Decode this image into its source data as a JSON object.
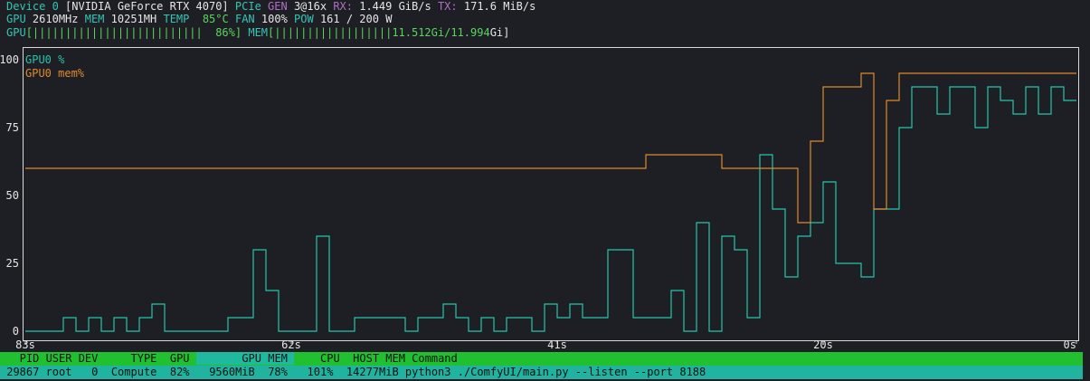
{
  "device": {
    "label": "Device 0",
    "name": "[NVIDIA GeForce RTX 4070]",
    "pcie_label": "PCIe",
    "gen_label": "GEN",
    "gen_value": "3@16x",
    "rx_label": "RX:",
    "rx_value": "1.449 GiB/s",
    "tx_label": "TX:",
    "tx_value": "171.6 MiB/s"
  },
  "stats": {
    "gpu_label": "GPU",
    "gpu_clock": "2610MHz",
    "mem_label": "MEM",
    "mem_clock": "10251MH",
    "temp_label": "TEMP",
    "temp_value": "85°C",
    "fan_label": "FAN",
    "fan_value": "100%",
    "pow_label": "POW",
    "pow_value": "161 / 200 W"
  },
  "bars": {
    "gpu_label": "GPU",
    "gpu_bar": "[||||||||||||||||||||||||||  86%]",
    "mem_label": "MEM",
    "mem_bar_open": "[||||||||||||||||||",
    "mem_bar_value": "11.512Gi/11.994",
    "mem_bar_close": "Gi]"
  },
  "chart_data": {
    "type": "line",
    "series": [
      {
        "name": "GPU0 %",
        "color": "#26c4aa",
        "x": [
          83,
          82,
          81,
          80,
          79,
          78,
          77,
          76,
          75,
          74,
          73,
          72,
          71,
          70,
          69,
          68,
          67,
          66,
          65,
          64,
          63,
          62,
          61,
          60,
          59,
          58,
          57,
          56,
          55,
          54,
          53,
          52,
          51,
          50,
          49,
          48,
          47,
          46,
          45,
          44,
          43,
          42,
          41,
          40,
          39,
          38,
          37,
          36,
          35,
          34,
          33,
          32,
          31,
          30,
          29,
          28,
          27,
          26,
          25,
          24,
          23,
          22,
          21,
          20,
          19,
          18,
          17,
          16,
          15,
          14,
          13,
          12,
          11,
          10,
          9,
          8,
          7,
          6,
          5,
          4,
          3,
          2,
          1,
          0
        ],
        "values": [
          0,
          0,
          0,
          5,
          0,
          5,
          0,
          5,
          0,
          5,
          10,
          0,
          0,
          0,
          0,
          0,
          5,
          5,
          30,
          15,
          0,
          0,
          0,
          35,
          0,
          0,
          5,
          5,
          5,
          5,
          0,
          5,
          5,
          10,
          5,
          0,
          5,
          0,
          5,
          5,
          0,
          10,
          5,
          10,
          5,
          5,
          30,
          30,
          5,
          5,
          5,
          15,
          0,
          40,
          0,
          35,
          30,
          5,
          65,
          45,
          20,
          35,
          40,
          55,
          25,
          25,
          20,
          45,
          45,
          75,
          90,
          90,
          80,
          90,
          90,
          75,
          90,
          85,
          80,
          90,
          80,
          90,
          85,
          85
        ]
      },
      {
        "name": "GPU0 mem%",
        "color": "#e08a2c",
        "x": [
          83,
          82,
          81,
          80,
          79,
          78,
          77,
          76,
          75,
          74,
          73,
          72,
          71,
          70,
          69,
          68,
          67,
          66,
          65,
          64,
          63,
          62,
          61,
          60,
          59,
          58,
          57,
          56,
          55,
          54,
          53,
          52,
          51,
          50,
          49,
          48,
          47,
          46,
          45,
          44,
          43,
          42,
          41,
          40,
          39,
          38,
          37,
          36,
          35,
          34,
          33,
          32,
          31,
          30,
          29,
          28,
          27,
          26,
          25,
          24,
          23,
          22,
          21,
          20,
          19,
          18,
          17,
          16,
          15,
          14,
          13,
          12,
          11,
          10,
          9,
          8,
          7,
          6,
          5,
          4,
          3,
          2,
          1,
          0
        ],
        "values": [
          60,
          60,
          60,
          60,
          60,
          60,
          60,
          60,
          60,
          60,
          60,
          60,
          60,
          60,
          60,
          60,
          60,
          60,
          60,
          60,
          60,
          60,
          60,
          60,
          60,
          60,
          60,
          60,
          60,
          60,
          60,
          60,
          60,
          60,
          60,
          60,
          60,
          60,
          60,
          60,
          60,
          60,
          60,
          60,
          60,
          60,
          60,
          60,
          60,
          65,
          65,
          65,
          65,
          65,
          65,
          60,
          60,
          60,
          60,
          60,
          60,
          40,
          70,
          90,
          90,
          90,
          95,
          45,
          85,
          95,
          95,
          95,
          95,
          95,
          95,
          95,
          95,
          95,
          95,
          95,
          95,
          95,
          95,
          95
        ]
      }
    ],
    "x_ticks": [
      "83s",
      "62s",
      "41s",
      "20s",
      "0s"
    ],
    "y_ticks": [
      "100",
      "75",
      "50",
      "25",
      "0"
    ],
    "ylim": [
      0,
      100
    ]
  },
  "process": {
    "header_pre": "   PID USER DEV     TYPE  GPU ",
    "header_hl": "       GPU MEM ",
    "header_post": "    CPU  HOST MEM Command",
    "rows": [
      " 29867 root   0  Compute  82%   9560MiB  78%   101%  14277MiB python3 ./ComfyUI/main.py --listen --port 8188"
    ]
  }
}
